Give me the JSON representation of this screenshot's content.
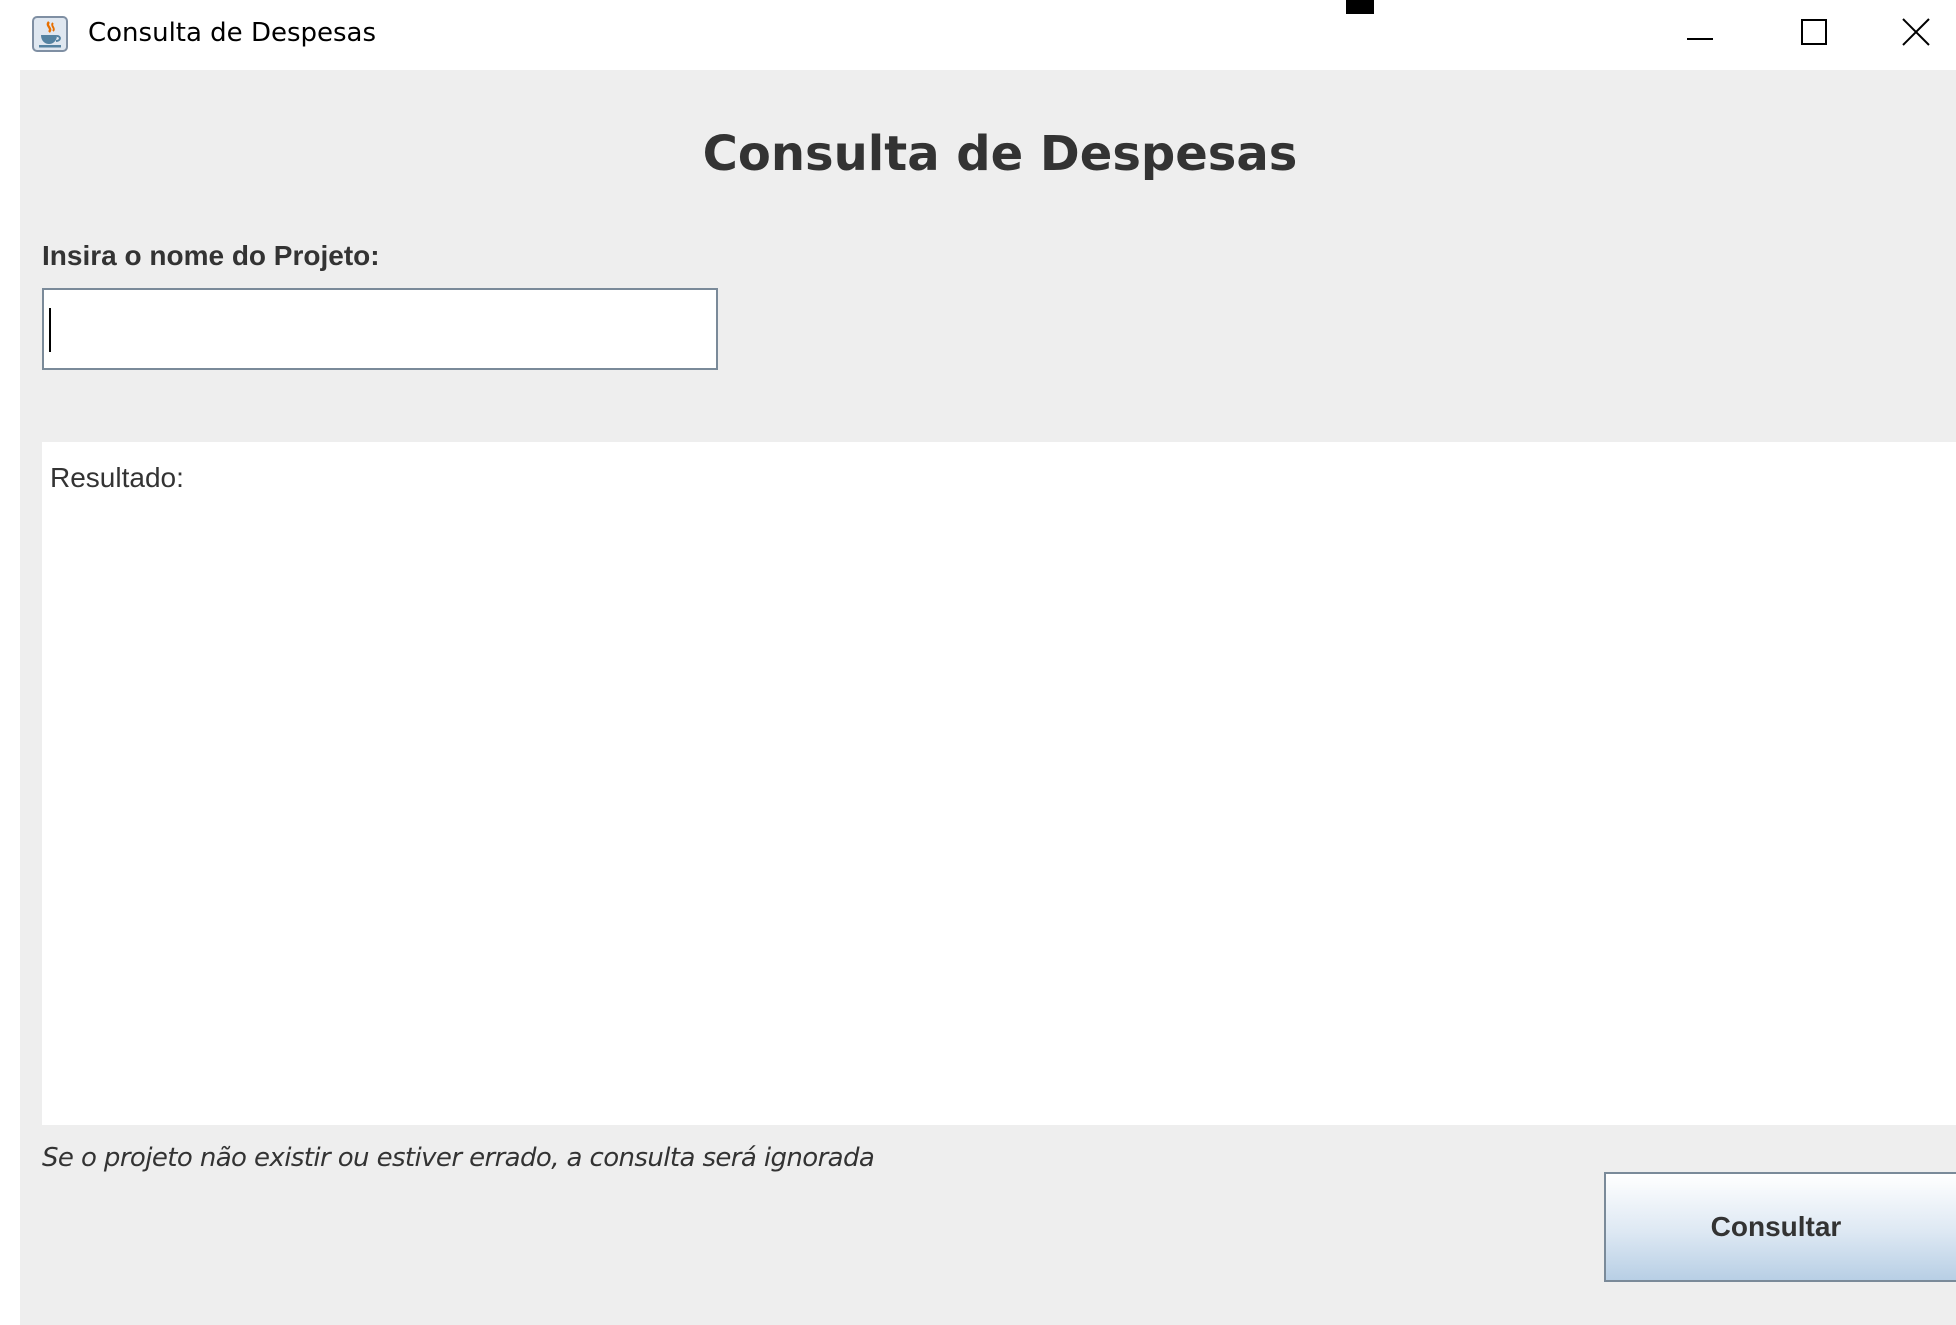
{
  "window": {
    "title": "Consulta de Despesas",
    "controls": {
      "minimize_icon": "minimize-icon",
      "maximize_icon": "maximize-icon",
      "close_icon": "close-icon"
    },
    "app_icon": "java-coffee-cup-icon"
  },
  "main": {
    "heading": "Consulta de Despesas",
    "project_label": "Insira o nome do Projeto:",
    "project_input": {
      "value": "",
      "placeholder": ""
    },
    "result_text": "Resultado:",
    "hint": "Se o projeto não existir ou estiver errado, a consulta será ignorada",
    "consult_button_label": "Consultar"
  },
  "colors": {
    "frame_background": "#eeeeee",
    "text": "#333333",
    "input_border": "#7a8a99",
    "button_gradient_bottom": "#b8cfe5"
  }
}
